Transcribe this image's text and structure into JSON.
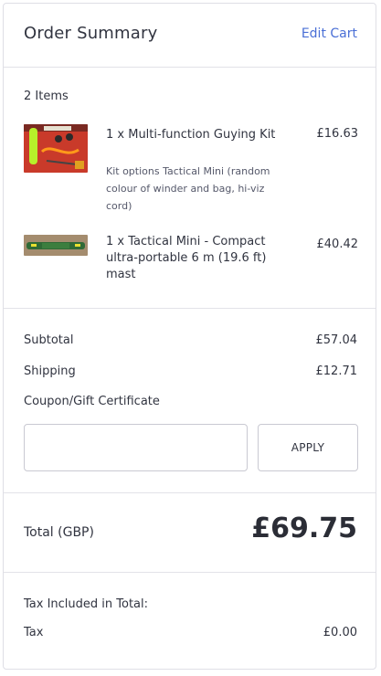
{
  "header": {
    "title": "Order Summary",
    "edit_cart": "Edit Cart"
  },
  "items_count": "2 Items",
  "items": [
    {
      "name": "1 x Multi-function Guying Kit",
      "options": "Kit options Tactical Mini (random colour of winder and bag, hi-viz cord)",
      "price": "£16.63"
    },
    {
      "name": "1 x Tactical Mini - Compact ultra-portable 6 m (19.6 ft) mast",
      "price": "£40.42"
    }
  ],
  "totals": {
    "subtotal_label": "Subtotal",
    "subtotal_value": "£57.04",
    "shipping_label": "Shipping",
    "shipping_value": "£12.71",
    "coupon_label": "Coupon/Gift Certificate",
    "coupon_value": "",
    "apply_label": "APPLY"
  },
  "grand_total": {
    "label": "Total (GBP)",
    "value": "£69.75"
  },
  "tax": {
    "heading": "Tax Included in Total:",
    "label": "Tax",
    "value": "£0.00"
  }
}
